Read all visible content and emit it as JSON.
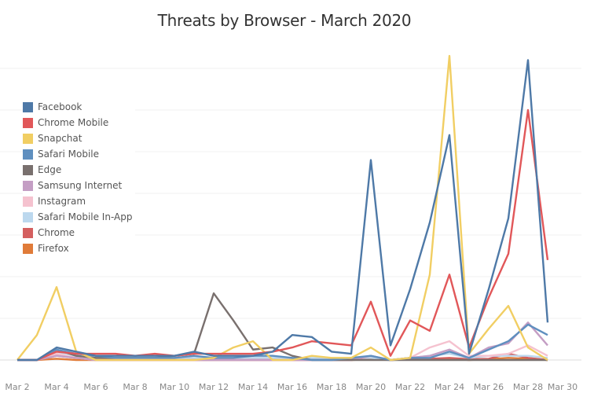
{
  "chart_data": {
    "type": "line",
    "title": "Threats by Browser - March 2020",
    "xlabel": "",
    "ylabel": "",
    "x": [
      "Mar 2",
      "Mar 3",
      "Mar 4",
      "Mar 5",
      "Mar 6",
      "Mar 7",
      "Mar 8",
      "Mar 9",
      "Mar 10",
      "Mar 11",
      "Mar 12",
      "Mar 13",
      "Mar 14",
      "Mar 15",
      "Mar 16",
      "Mar 17",
      "Mar 18",
      "Mar 19",
      "Mar 20",
      "Mar 21",
      "Mar 22",
      "Mar 23",
      "Mar 24",
      "Mar 25",
      "Mar 26",
      "Mar 27",
      "Mar 28",
      "Mar 29"
    ],
    "x_tick_labels": [
      "Mar 2",
      "Mar 4",
      "Mar 6",
      "Mar 8",
      "Mar 10",
      "Mar 12",
      "Mar 14",
      "Mar 16",
      "Mar 18",
      "Mar 20",
      "Mar 22",
      "Mar 24",
      "Mar 26",
      "Mar 28",
      "Mar 30"
    ],
    "ylim": [
      0,
      75
    ],
    "y_grid_step": 10,
    "grid": true,
    "y_tick_labels_visible": false,
    "legend_position": "left",
    "series": [
      {
        "name": "Facebook",
        "color": "#4e79a7",
        "values": [
          0,
          0,
          3,
          2,
          1,
          1,
          1,
          1,
          1,
          2,
          1,
          1,
          1,
          2,
          6,
          5.5,
          2,
          1.5,
          48,
          3.5,
          17,
          33,
          54,
          1.5,
          17,
          34,
          72,
          9
        ]
      },
      {
        "name": "Chrome Mobile",
        "color": "#e15759",
        "values": [
          0,
          0,
          2,
          1.5,
          1.5,
          1.5,
          1,
          1.5,
          1,
          1.5,
          1.5,
          1.5,
          1.5,
          2,
          3,
          4.5,
          4,
          3.5,
          14,
          1,
          9.5,
          7,
          20.5,
          3,
          15,
          25.5,
          60,
          24
        ]
      },
      {
        "name": "Snapchat",
        "color": "#f1ce63",
        "values": [
          0,
          6,
          17.5,
          2,
          0,
          0,
          0,
          0,
          0,
          0,
          0.5,
          3,
          4.5,
          0,
          0,
          1,
          0.5,
          0.5,
          3,
          0,
          0.5,
          20.5,
          73,
          1.5,
          7.5,
          13,
          3,
          0
        ]
      },
      {
        "name": "Safari Mobile",
        "color": "#5f8fbf",
        "values": [
          0,
          0,
          2.5,
          1.5,
          1,
          0.5,
          0.5,
          0.5,
          0.5,
          1,
          0.5,
          0.5,
          1,
          1,
          0.5,
          0,
          0,
          0.5,
          1,
          0,
          0.5,
          0.5,
          2,
          0.5,
          2.5,
          4.5,
          8.5,
          6
        ]
      },
      {
        "name": "Edge",
        "color": "#79706e",
        "values": [
          0,
          0,
          2.5,
          1,
          0.5,
          0.5,
          0.5,
          0.5,
          1,
          1.5,
          16,
          9.5,
          2.5,
          3,
          1,
          0,
          0,
          0,
          0,
          0,
          0,
          0,
          0,
          0,
          0,
          0,
          0,
          0
        ]
      },
      {
        "name": "Samsung Internet",
        "color": "#c49ec4",
        "values": [
          0,
          0,
          1,
          0.5,
          0,
          0,
          0,
          0,
          0,
          0,
          0,
          0,
          0,
          0,
          0,
          0,
          0,
          0,
          1,
          0,
          0.5,
          1,
          2.5,
          0.5,
          3,
          4,
          9,
          3.5
        ]
      },
      {
        "name": "Instagram",
        "color": "#f5c2cf",
        "values": [
          0,
          0,
          1.5,
          0.5,
          0,
          0,
          0,
          0,
          0,
          0,
          0,
          0,
          0,
          0,
          0,
          0,
          0,
          0,
          1,
          0,
          0.5,
          3,
          4.5,
          1,
          1,
          1.5,
          3.5,
          1
        ]
      },
      {
        "name": "Safari Mobile In-App",
        "color": "#bcd8ee",
        "values": [
          0,
          0,
          2,
          1,
          0.5,
          0.5,
          0.5,
          0.5,
          0.5,
          0.5,
          0.5,
          0.5,
          0.5,
          0.5,
          0.5,
          0.5,
          0.5,
          0.5,
          0.5,
          0,
          0.5,
          1,
          1.5,
          0.5,
          1,
          1,
          1,
          0.5
        ]
      },
      {
        "name": "Chrome",
        "color": "#d45f5f",
        "values": [
          0,
          0,
          1,
          0.5,
          0,
          0,
          0,
          0,
          0,
          0,
          0,
          0,
          0,
          0,
          0,
          0,
          0,
          0,
          0.5,
          0,
          0.3,
          0.3,
          0.5,
          0.2,
          0.3,
          1.5,
          0.5,
          0
        ]
      },
      {
        "name": "Firefox",
        "color": "#e07b39",
        "values": [
          0,
          0,
          0.3,
          0,
          0,
          0,
          0,
          0,
          0,
          0,
          0,
          0,
          0,
          0,
          0,
          0,
          0,
          0,
          0.2,
          0,
          0.2,
          0.2,
          0.3,
          0,
          0.2,
          0.5,
          0.3,
          0
        ]
      }
    ]
  }
}
